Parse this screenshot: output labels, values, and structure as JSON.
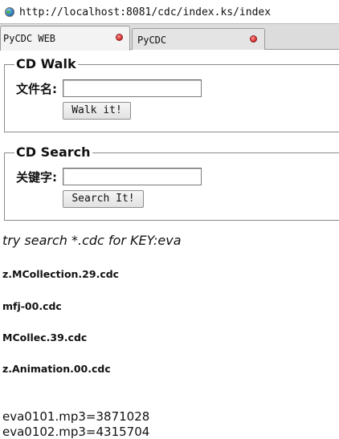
{
  "browser": {
    "url": "http://localhost:8081/cdc/index.ks/index",
    "tabs": [
      {
        "label": "PyCDC WEB",
        "active": true
      },
      {
        "label": "PyCDC",
        "active": false
      }
    ]
  },
  "walk": {
    "legend": "CD Walk",
    "field_label": "文件名:",
    "value": "",
    "button_label": "Walk it!"
  },
  "search": {
    "legend": "CD Search",
    "field_label": "关键字:",
    "value": "",
    "button_label": "Search It!"
  },
  "hint": "try search *.cdc for KEY:eva",
  "files": [
    "z.MCollection.29.cdc",
    "mfj-00.cdc",
    "MCollec.39.cdc",
    "z.Animation.00.cdc"
  ],
  "results": [
    "eva0101.mp3=3871028",
    "eva0102.mp3=4315704"
  ]
}
